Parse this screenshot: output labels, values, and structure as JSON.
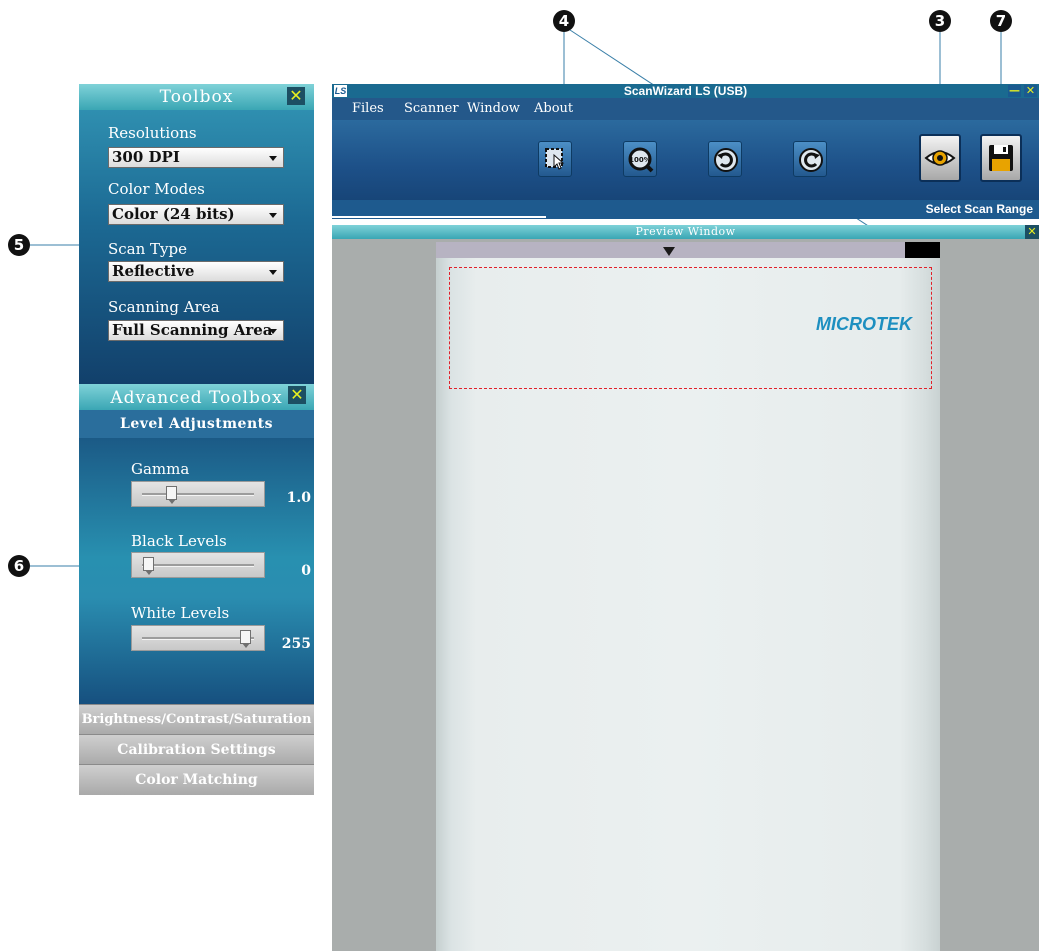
{
  "callouts": {
    "three": "3",
    "four": "4",
    "five": "5",
    "six": "6",
    "seven": "7"
  },
  "toolbox": {
    "title": "Toolbox",
    "close_icon": "close-x-icon",
    "resolutions": {
      "label": "Resolutions",
      "value": "300 DPI"
    },
    "color_modes": {
      "label": "Color Modes",
      "value": "Color (24 bits)"
    },
    "scan_type": {
      "label": "Scan Type",
      "value": "Reflective"
    },
    "scanning_area": {
      "label": "Scanning Area",
      "value": "Full Scanning Area"
    }
  },
  "advanced_toolbox": {
    "title": "Advanced Toolbox",
    "close_icon": "close-x-icon",
    "level_adjustments": "Level Adjustments",
    "gamma": {
      "label": "Gamma",
      "value": "1.0"
    },
    "black_levels": {
      "label": "Black Levels",
      "value": "0",
      "value_num": 0
    },
    "white_levels": {
      "label": "White Levels",
      "value": "255",
      "value_num": 255
    },
    "sections": [
      "Brightness/Contrast/Saturation",
      "Calibration Settings",
      "Color Matching"
    ]
  },
  "window": {
    "title": "ScanWizard LS (USB)",
    "logo": "LS",
    "minimize_icon": "minimize-icon",
    "close_icon": "close-x-icon",
    "menu": [
      "Files",
      "Scanner",
      "Window",
      "About"
    ],
    "toolbar_icons": [
      "select-area-icon",
      "zoom-100-icon",
      "rotate-left-icon",
      "rotate-right-icon",
      "preview-eye-icon",
      "save-scan-icon"
    ],
    "zoom_label": "100%",
    "status_text": "Select Scan Range",
    "preview_title": "Preview Window",
    "preview_close_icon": "close-x-icon",
    "brand": "MICROTEK"
  }
}
